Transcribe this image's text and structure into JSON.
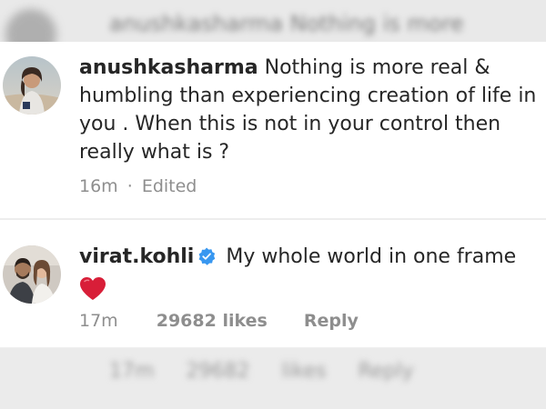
{
  "background": {
    "blurred_top_text": "anushkasharma Nothing is more",
    "blurred_bottom_time": "17m",
    "blurred_bottom_likes": "29682 likes",
    "blurred_bottom_reply": "Reply"
  },
  "comments": [
    {
      "username": "anushkasharma",
      "text": "Nothing is more real & humbling than experiencing creation of life in you . When this is not in your control then really what is ?",
      "time": "16m",
      "separator": "·",
      "status": "Edited",
      "verified": false,
      "avatar_icon": "profile-avatar-icon"
    },
    {
      "username": "virat.kohli",
      "text": "My whole world in one frame",
      "time": "17m",
      "likes": "29682 likes",
      "reply_label": "Reply",
      "verified": true,
      "verified_icon": "verified-badge-icon",
      "emoji": "red-heart-icon",
      "avatar_icon": "profile-avatar-icon"
    }
  ],
  "colors": {
    "text_primary": "#262626",
    "text_secondary": "#8e8e8e",
    "verified_blue": "#3897f0",
    "heart_red": "#e0245e"
  }
}
